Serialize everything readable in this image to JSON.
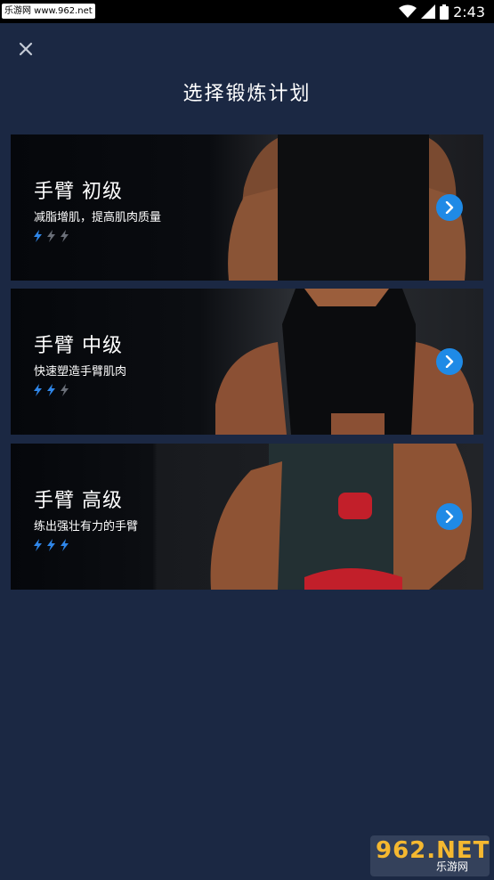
{
  "status_bar": {
    "watermark": "乐游网 www.962.net",
    "time": "2:43",
    "icons": [
      "wifi-icon",
      "signal-icon",
      "battery-icon"
    ]
  },
  "header": {
    "close_icon": "close-icon",
    "title": "选择锻炼计划"
  },
  "plans": [
    {
      "title": "手臂 初级",
      "subtitle": "减脂增肌，提高肌肉质量",
      "level": 1,
      "max_level": 3
    },
    {
      "title": "手臂 中级",
      "subtitle": "快速塑造手臂肌肉",
      "level": 2,
      "max_level": 3
    },
    {
      "title": "手臂 高级",
      "subtitle": "练出强壮有力的手臂",
      "level": 3,
      "max_level": 3
    }
  ],
  "colors": {
    "background": "#1b2843",
    "accent": "#1f8ae6",
    "bolt_active": "#2f86e8",
    "bolt_inactive": "#6a6f78"
  },
  "watermark_bottom": {
    "logo": "962.NET",
    "text": "乐游网"
  }
}
